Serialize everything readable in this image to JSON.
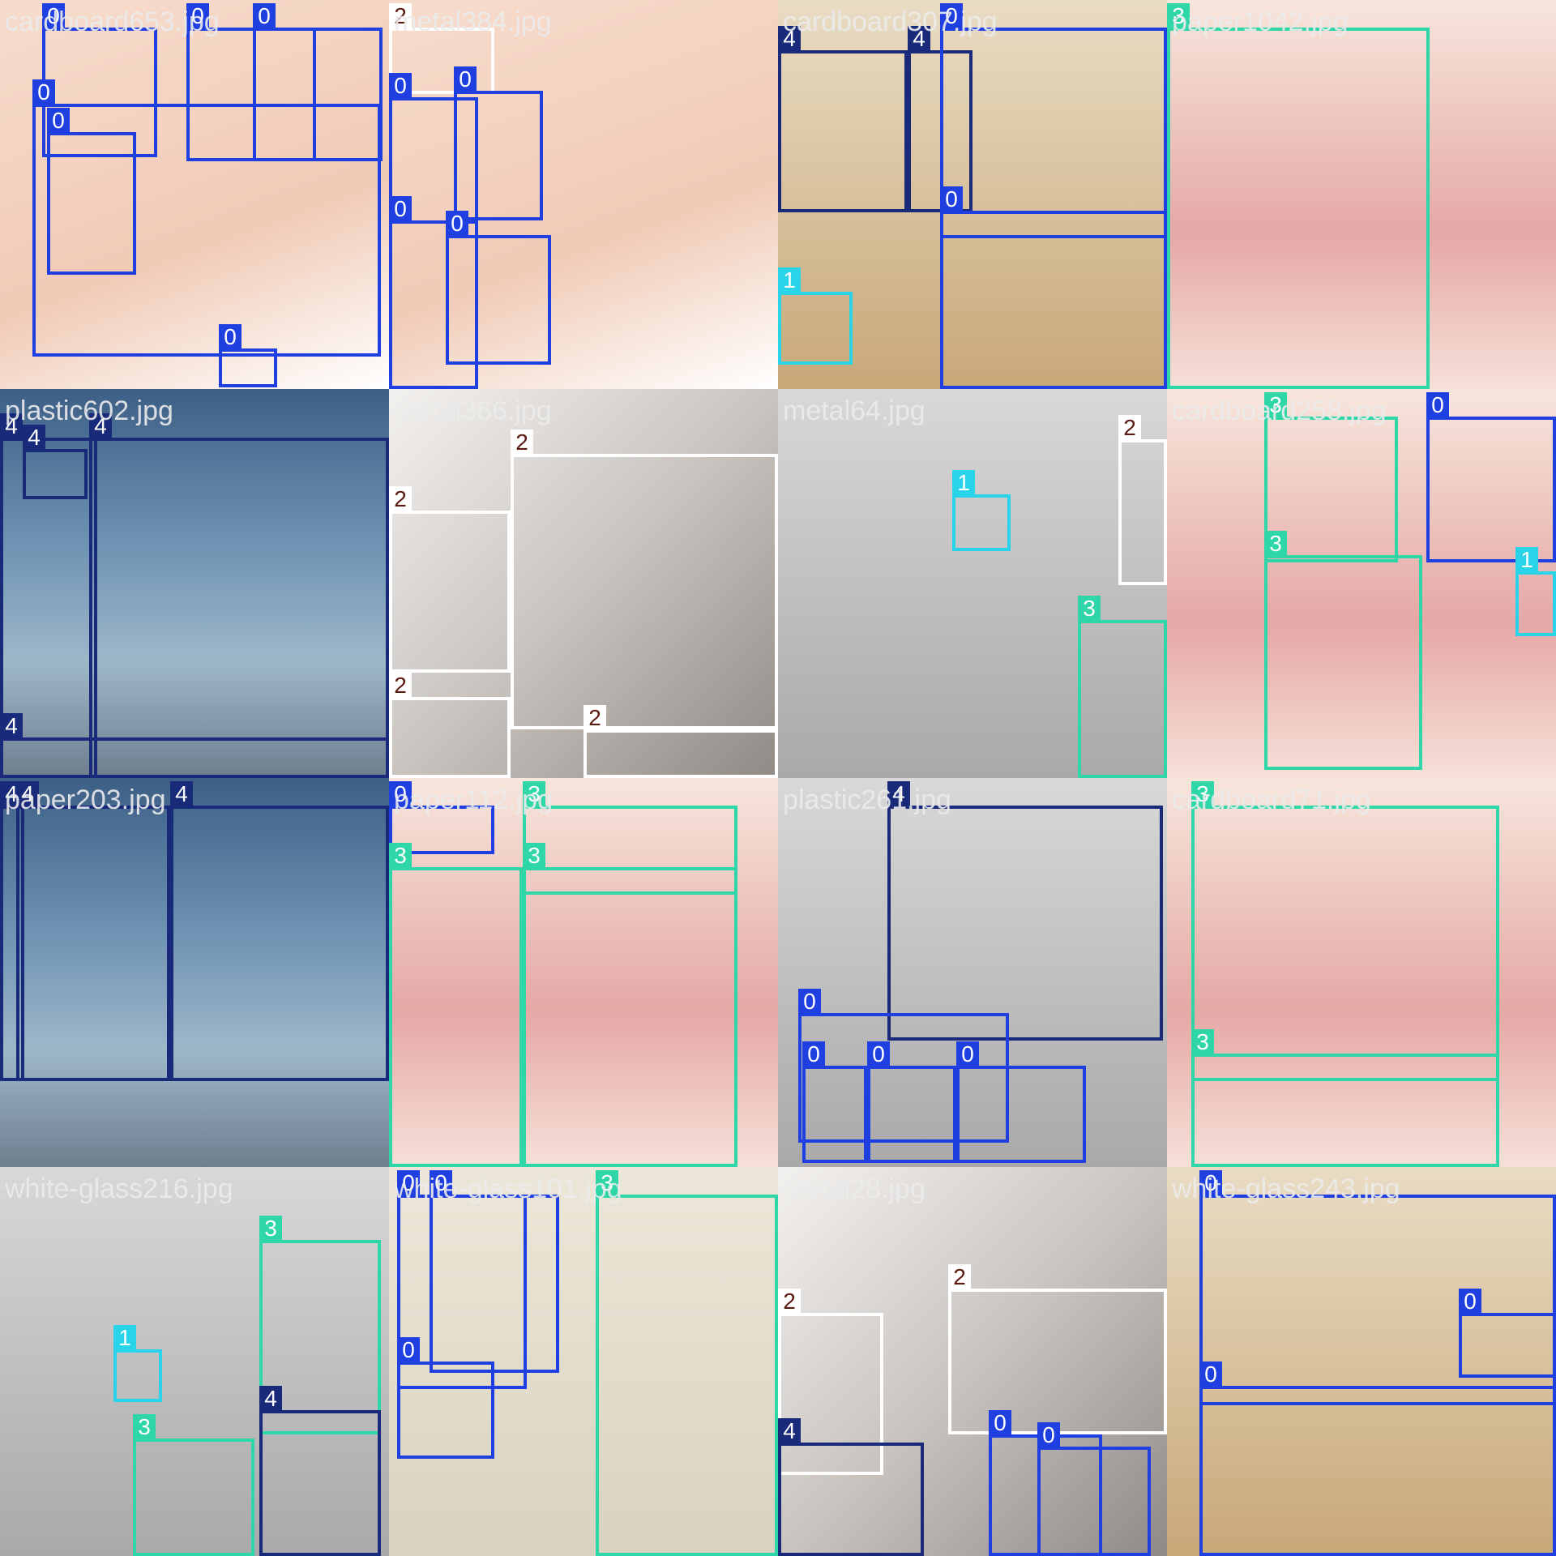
{
  "tiles": [
    {
      "filename": "cardboard653.jpg",
      "scene": "cardboard",
      "boxes": [
        {
          "label": "0",
          "cls": 0
        },
        {
          "label": "0",
          "cls": 0
        },
        {
          "label": "0",
          "cls": 0
        },
        {
          "label": "0",
          "cls": 0
        },
        {
          "label": "0",
          "cls": 0
        },
        {
          "label": "0",
          "cls": 0
        }
      ]
    },
    {
      "filename": "metal384.jpg",
      "scene": "cardboard",
      "boxes": [
        {
          "label": "2",
          "cls": 2
        },
        {
          "label": "0",
          "cls": 0
        },
        {
          "label": "0",
          "cls": 0
        },
        {
          "label": "0",
          "cls": 0
        },
        {
          "label": "0",
          "cls": 0
        }
      ]
    },
    {
      "filename": "cardboard307.jpg",
      "scene": "box",
      "boxes": [
        {
          "label": "4",
          "cls": 4
        },
        {
          "label": "4",
          "cls": 4
        },
        {
          "label": "0",
          "cls": 0
        },
        {
          "label": "0",
          "cls": 0
        },
        {
          "label": "1",
          "cls": 1
        }
      ]
    },
    {
      "filename": "paper1042.jpg",
      "scene": "magazine",
      "boxes": [
        {
          "label": "3",
          "cls": 3
        }
      ]
    },
    {
      "filename": "plastic602.jpg",
      "scene": "bottles",
      "boxes": [
        {
          "label": "4",
          "cls": 4
        },
        {
          "label": "4",
          "cls": 4
        },
        {
          "label": "4",
          "cls": 4
        },
        {
          "label": "4",
          "cls": 4
        }
      ]
    },
    {
      "filename": "metal366.jpg",
      "scene": "metal",
      "boxes": [
        {
          "label": "2",
          "cls": 2
        },
        {
          "label": "2",
          "cls": 2
        },
        {
          "label": "2",
          "cls": 2
        },
        {
          "label": "2",
          "cls": 2
        }
      ]
    },
    {
      "filename": "metal64.jpg",
      "scene": "glass",
      "boxes": [
        {
          "label": "1",
          "cls": 1
        },
        {
          "label": "2",
          "cls": 2
        },
        {
          "label": "3",
          "cls": 3
        }
      ]
    },
    {
      "filename": "cardboard258.jpg",
      "scene": "magazine",
      "boxes": [
        {
          "label": "3",
          "cls": 3
        },
        {
          "label": "0",
          "cls": 0
        },
        {
          "label": "3",
          "cls": 3
        },
        {
          "label": "1",
          "cls": 1
        }
      ]
    },
    {
      "filename": "paper203.jpg",
      "scene": "bottles",
      "boxes": [
        {
          "label": "4",
          "cls": 4
        },
        {
          "label": "4",
          "cls": 4
        },
        {
          "label": "4",
          "cls": 4
        }
      ]
    },
    {
      "filename": "paper112.jpg",
      "scene": "magazine",
      "boxes": [
        {
          "label": "0",
          "cls": 0
        },
        {
          "label": "3",
          "cls": 3
        },
        {
          "label": "3",
          "cls": 3
        },
        {
          "label": "3",
          "cls": 3
        }
      ]
    },
    {
      "filename": "plastic261.jpg",
      "scene": "glass",
      "boxes": [
        {
          "label": "4",
          "cls": 4
        },
        {
          "label": "0",
          "cls": 0
        },
        {
          "label": "0",
          "cls": 0
        },
        {
          "label": "0",
          "cls": 0
        },
        {
          "label": "0",
          "cls": 0
        }
      ]
    },
    {
      "filename": "cardboard71.jpg",
      "scene": "magazine",
      "boxes": [
        {
          "label": "3",
          "cls": 3
        },
        {
          "label": "3",
          "cls": 3
        }
      ]
    },
    {
      "filename": "white-glass216.jpg",
      "scene": "glass",
      "boxes": [
        {
          "label": "1",
          "cls": 1
        },
        {
          "label": "3",
          "cls": 3
        },
        {
          "label": "3",
          "cls": 3
        },
        {
          "label": "4",
          "cls": 4
        }
      ]
    },
    {
      "filename": "white-glass101.jpg",
      "scene": "paper",
      "boxes": [
        {
          "label": "0",
          "cls": 0
        },
        {
          "label": "0",
          "cls": 0
        },
        {
          "label": "0",
          "cls": 0
        },
        {
          "label": "3",
          "cls": 3
        }
      ]
    },
    {
      "filename": "metal28.jpg",
      "scene": "metal",
      "boxes": [
        {
          "label": "2",
          "cls": 2
        },
        {
          "label": "2",
          "cls": 2
        },
        {
          "label": "4",
          "cls": 4
        },
        {
          "label": "0",
          "cls": 0
        },
        {
          "label": "0",
          "cls": 0
        }
      ]
    },
    {
      "filename": "white-glass243.jpg",
      "scene": "box",
      "boxes": [
        {
          "label": "0",
          "cls": 0
        },
        {
          "label": "0",
          "cls": 0
        },
        {
          "label": "0",
          "cls": 0
        }
      ]
    }
  ]
}
